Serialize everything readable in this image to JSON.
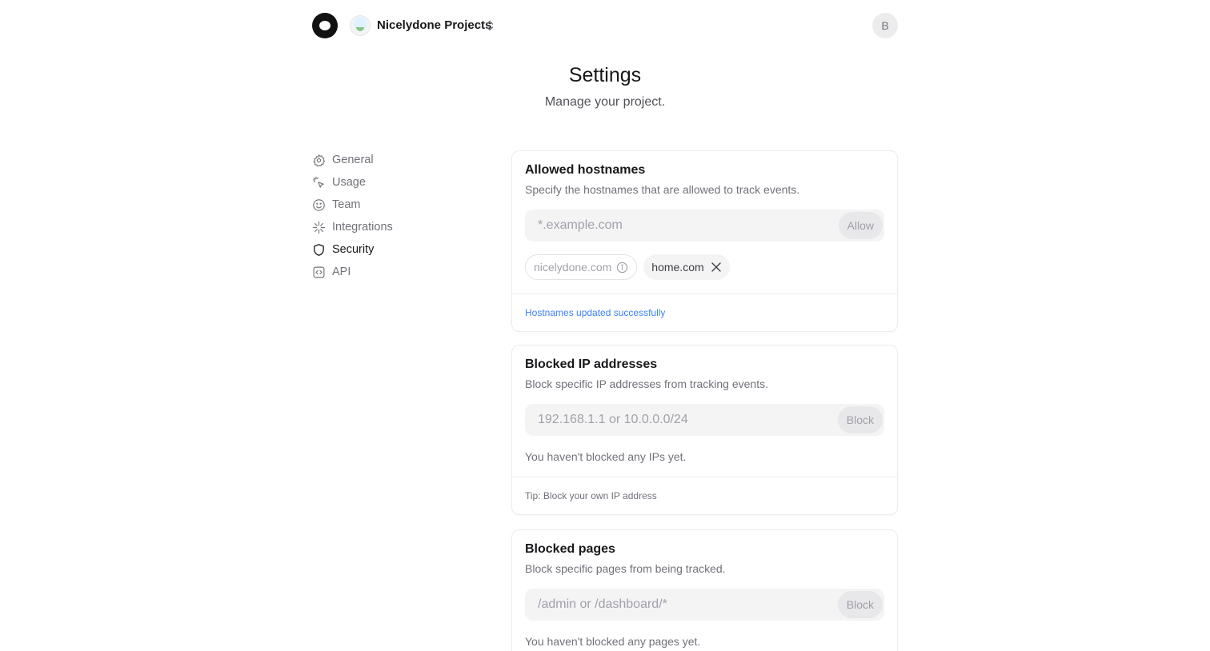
{
  "header": {
    "logo_icon": "app-logo-icon",
    "project_avatar_icon": "project-globe-avatar",
    "project_name": "Nicelydone Projects",
    "switch_icon": "chevron-up-down-icon",
    "user_initial": "B"
  },
  "page": {
    "title": "Settings",
    "subtitle": "Manage your project."
  },
  "sidebar": {
    "items": [
      {
        "label": "General",
        "icon": "gear-icon",
        "active": false
      },
      {
        "label": "Usage",
        "icon": "cursor-click-icon",
        "active": false
      },
      {
        "label": "Team",
        "icon": "smiley-icon",
        "active": false
      },
      {
        "label": "Integrations",
        "icon": "sparkle-icon",
        "active": false
      },
      {
        "label": "Security",
        "icon": "shield-icon",
        "active": true
      },
      {
        "label": "API",
        "icon": "code-brackets-icon",
        "active": false
      }
    ]
  },
  "hostnames": {
    "title": "Allowed hostnames",
    "description": "Specify the hostnames that are allowed to track events.",
    "placeholder": "*.example.com",
    "button_label": "Allow",
    "chips": [
      {
        "label": "nicelydone.com",
        "kind": "default",
        "icon": "info-icon"
      },
      {
        "label": "home.com",
        "kind": "removable",
        "icon": "close-icon"
      }
    ],
    "footer": "Hostnames updated successfully"
  },
  "blocked_ips": {
    "title": "Blocked IP addresses",
    "description": "Block specific IP addresses from tracking events.",
    "placeholder": "192.168.1.1 or 10.0.0.0/24",
    "button_label": "Block",
    "empty_text": "You haven't blocked any IPs yet.",
    "footer": "Tip: Block your own IP address"
  },
  "blocked_pages": {
    "title": "Blocked pages",
    "description": "Block specific pages from being tracked.",
    "placeholder": "/admin or /dashboard/*",
    "button_label": "Block",
    "empty_text": "You haven't blocked any pages yet."
  },
  "colors": {
    "success_text": "#3b82f6",
    "muted_text": "#71717a",
    "input_bg": "#f4f4f5"
  }
}
